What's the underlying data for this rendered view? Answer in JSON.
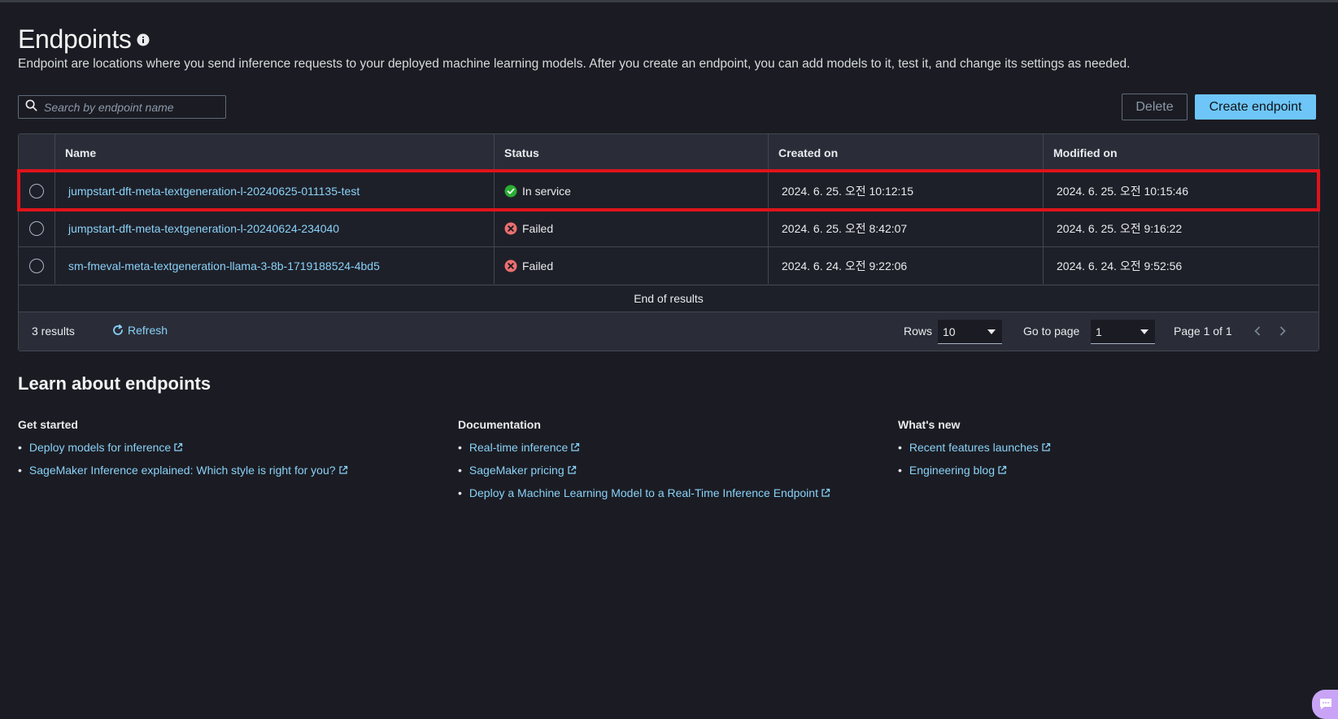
{
  "header": {
    "title": "Endpoints",
    "description": "Endpoint are locations where you send inference requests to your deployed machine learning models. After you create an endpoint, you can add models to it, test it, and change its settings as needed."
  },
  "search": {
    "placeholder": "Search by endpoint name",
    "value": ""
  },
  "actions": {
    "delete_label": "Delete",
    "create_label": "Create endpoint"
  },
  "table": {
    "columns": [
      "Name",
      "Status",
      "Created on",
      "Modified on"
    ],
    "rows": [
      {
        "name": "jumpstart-dft-meta-textgeneration-l-20240625-011135-test",
        "status": "In service",
        "status_type": "success",
        "created": "2024. 6. 25. 오전 10:12:15",
        "modified": "2024. 6. 25. 오전 10:15:46"
      },
      {
        "name": "jumpstart-dft-meta-textgeneration-l-20240624-234040",
        "status": "Failed",
        "status_type": "error",
        "created": "2024. 6. 25. 오전 8:42:07",
        "modified": "2024. 6. 25. 오전 9:16:22"
      },
      {
        "name": "sm-fmeval-meta-textgeneration-llama-3-8b-1719188524-4bd5",
        "status": "Failed",
        "status_type": "error",
        "created": "2024. 6. 24. 오전 9:22:06",
        "modified": "2024. 6. 24. 오전 9:52:56"
      }
    ],
    "end_text": "End of results"
  },
  "footer": {
    "results_count": "3 results",
    "refresh_label": "Refresh",
    "rows_label": "Rows",
    "rows_value": "10",
    "goto_label": "Go to page",
    "goto_value": "1",
    "page_info": "Page 1 of 1"
  },
  "learn": {
    "title": "Learn about endpoints",
    "columns": [
      {
        "heading": "Get started",
        "links": [
          "Deploy models for inference",
          "SageMaker Inference explained: Which style is right for you?"
        ]
      },
      {
        "heading": "Documentation",
        "links": [
          "Real-time inference",
          "SageMaker pricing",
          "Deploy a Machine Learning Model to a Real-Time Inference Endpoint"
        ]
      },
      {
        "heading": "What's new",
        "links": [
          "Recent features launches",
          "Engineering blog"
        ]
      }
    ]
  },
  "colors": {
    "background": "#1b1c23",
    "link": "#89d2f8",
    "primary_button": "#6ec6f8",
    "success": "#29ad32",
    "error": "#eb6f6f",
    "highlight": "#e0131b"
  },
  "icons": [
    "info-icon",
    "search-icon",
    "check-circle-icon",
    "error-circle-icon",
    "refresh-icon",
    "caret-down-icon",
    "chevron-left-icon",
    "chevron-right-icon",
    "external-link-icon",
    "chat-icon"
  ]
}
